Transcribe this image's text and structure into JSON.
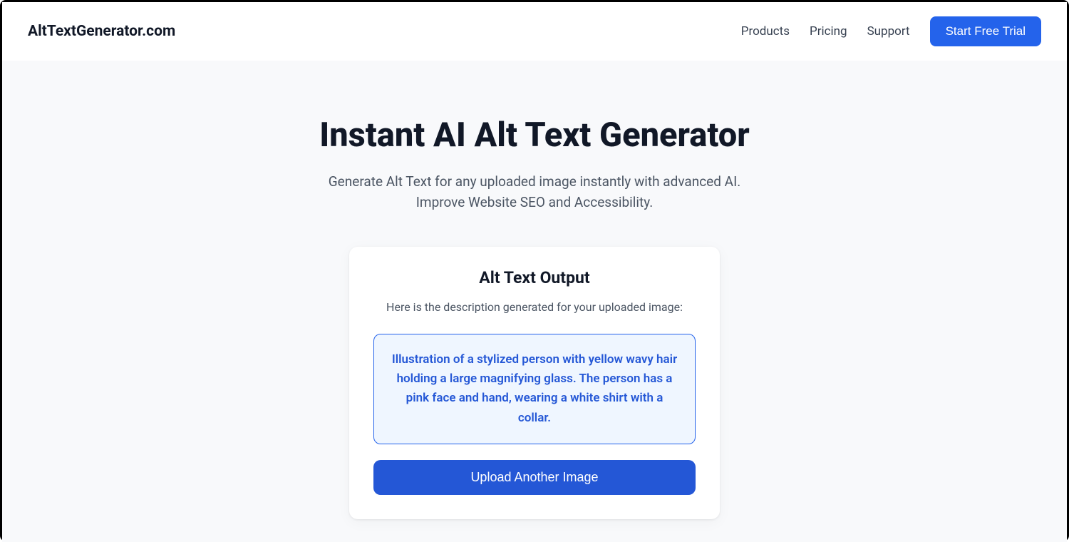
{
  "header": {
    "logo": "AltTextGenerator.com",
    "nav": {
      "products": "Products",
      "pricing": "Pricing",
      "support": "Support"
    },
    "cta": "Start Free Trial"
  },
  "hero": {
    "title": "Instant AI Alt Text Generator",
    "subtitle": "Generate Alt Text for any uploaded image instantly with advanced AI. Improve Website SEO and Accessibility."
  },
  "card": {
    "title": "Alt Text Output",
    "subtitle": "Here is the description generated for your uploaded image:",
    "output": "Illustration of a stylized person with yellow wavy hair holding a large magnifying glass. The person has a pink face and hand, wearing a white shirt with a collar.",
    "button": "Upload Another Image"
  }
}
